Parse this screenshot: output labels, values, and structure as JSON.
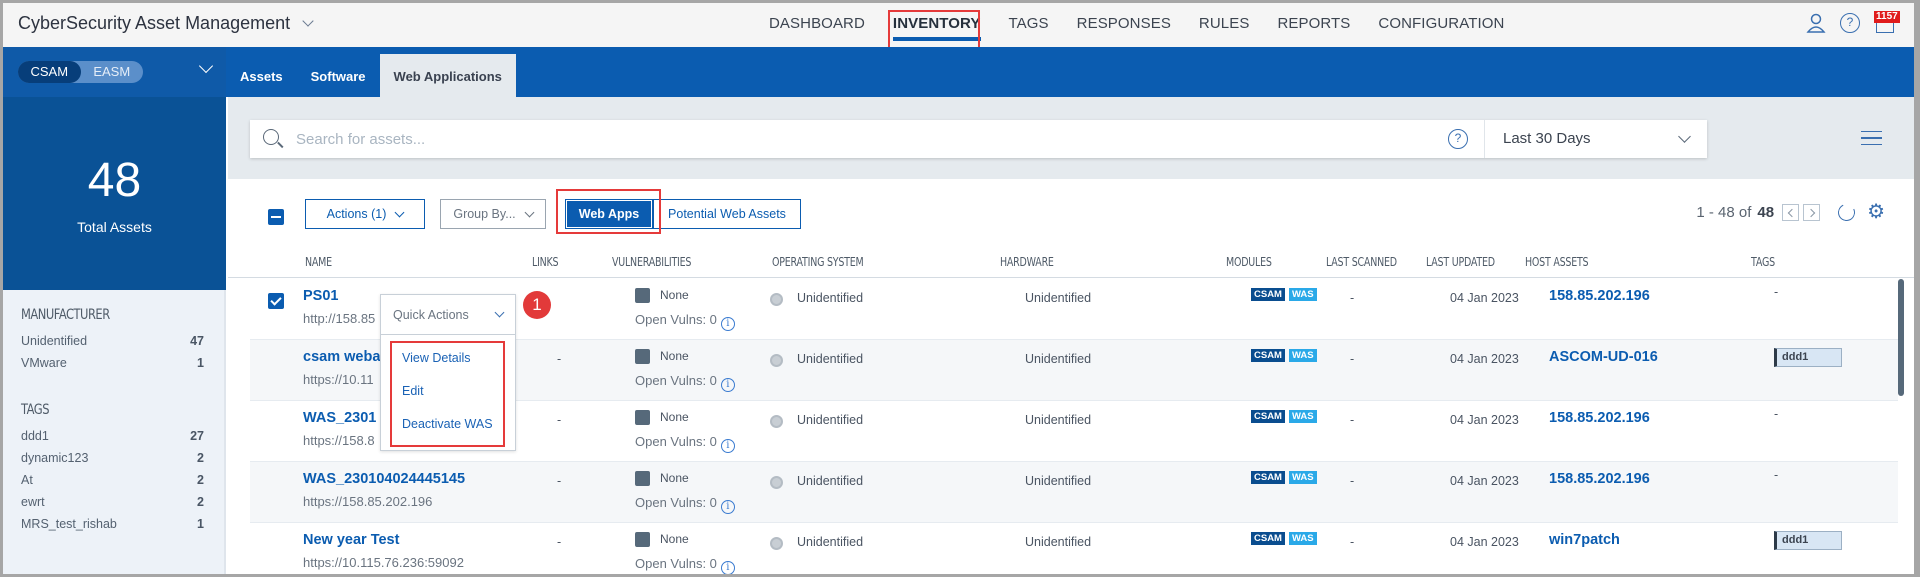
{
  "app": {
    "title": "CyberSecurity Asset Management",
    "notification_count": "1157"
  },
  "nav": {
    "items": [
      "DASHBOARD",
      "INVENTORY",
      "TAGS",
      "RESPONSES",
      "RULES",
      "REPORTS",
      "CONFIGURATION"
    ],
    "active": "INVENTORY"
  },
  "module_switch": {
    "options": [
      "CSAM",
      "EASM"
    ],
    "active": "CSAM"
  },
  "subtabs": {
    "items": [
      "Assets",
      "Software",
      "Web Applications"
    ],
    "active": "Web Applications"
  },
  "summary": {
    "total": "48",
    "label": "Total Assets"
  },
  "facets": {
    "manufacturer": {
      "title": "MANUFACTURER",
      "items": [
        {
          "label": "Unidentified",
          "count": "47"
        },
        {
          "label": "VMware",
          "count": "1"
        }
      ]
    },
    "tags": {
      "title": "TAGS",
      "items": [
        {
          "label": "ddd1",
          "count": "27"
        },
        {
          "label": "dynamic123",
          "count": "2"
        },
        {
          "label": "At",
          "count": "2"
        },
        {
          "label": "ewrt",
          "count": "2"
        },
        {
          "label": "MRS_test_rishab",
          "count": "1"
        }
      ]
    }
  },
  "search": {
    "placeholder": "Search for assets...",
    "value": "",
    "help": "?",
    "date_range": "Last 30 Days"
  },
  "toolbar": {
    "actions_label": "Actions (1)",
    "group_by_label": "Group By...",
    "web_apps_label": "Web Apps",
    "potential_label": "Potential Web Assets",
    "pager_range": "1 - 48 of",
    "pager_total": "48"
  },
  "table": {
    "columns": [
      "NAME",
      "LINKS",
      "VULNERABILITIES",
      "OPERATING SYSTEM",
      "HARDWARE",
      "MODULES",
      "LAST SCANNED",
      "LAST UPDATED",
      "HOST ASSETS",
      "TAGS"
    ],
    "rows": [
      {
        "name": "PS01",
        "url": "http://158.85",
        "links": "",
        "vuln": "None",
        "open_vulns": "Open Vulns: 0",
        "os": "Unidentified",
        "hardware": "Unidentified",
        "modules": [
          "CSAM",
          "WAS"
        ],
        "last_scanned": "-",
        "last_updated": "04 Jan 2023",
        "host": "158.85.202.196",
        "tag": "-",
        "checked": true
      },
      {
        "name": "csam weba",
        "url": "https://10.11",
        "links": "-",
        "vuln": "None",
        "open_vulns": "Open Vulns: 0",
        "os": "Unidentified",
        "hardware": "Unidentified",
        "modules": [
          "CSAM",
          "WAS"
        ],
        "last_scanned": "-",
        "last_updated": "04 Jan 2023",
        "host": "ASCOM-UD-016",
        "tag": "ddd1",
        "checked": false
      },
      {
        "name": "WAS_2301",
        "url": "https://158.8",
        "links": "-",
        "vuln": "None",
        "open_vulns": "Open Vulns: 0",
        "os": "Unidentified",
        "hardware": "Unidentified",
        "modules": [
          "CSAM",
          "WAS"
        ],
        "last_scanned": "-",
        "last_updated": "04 Jan 2023",
        "host": "158.85.202.196",
        "tag": "-",
        "checked": false
      },
      {
        "name": "WAS_230104024445145",
        "url": "https://158.85.202.196",
        "links": "-",
        "vuln": "None",
        "open_vulns": "Open Vulns: 0",
        "os": "Unidentified",
        "hardware": "Unidentified",
        "modules": [
          "CSAM",
          "WAS"
        ],
        "last_scanned": "-",
        "last_updated": "04 Jan 2023",
        "host": "158.85.202.196",
        "tag": "-",
        "checked": false
      },
      {
        "name": "New year Test",
        "url": "https://10.115.76.236:59092",
        "links": "-",
        "vuln": "None",
        "open_vulns": "Open Vulns: 0",
        "os": "Unidentified",
        "hardware": "Unidentified",
        "modules": [
          "CSAM",
          "WAS"
        ],
        "last_scanned": "-",
        "last_updated": "04 Jan 2023",
        "host": "win7patch",
        "tag": "ddd1",
        "checked": false
      }
    ]
  },
  "quick_actions": {
    "label": "Quick Actions",
    "items": [
      "View Details",
      "Edit",
      "Deactivate WAS"
    ],
    "step_badge": "1"
  },
  "colors": {
    "brand_blue": "#0b5cb0",
    "highlight_red": "#e53a3a",
    "was_badge": "#2aa9e8",
    "csam_badge": "#0a4d8f"
  }
}
